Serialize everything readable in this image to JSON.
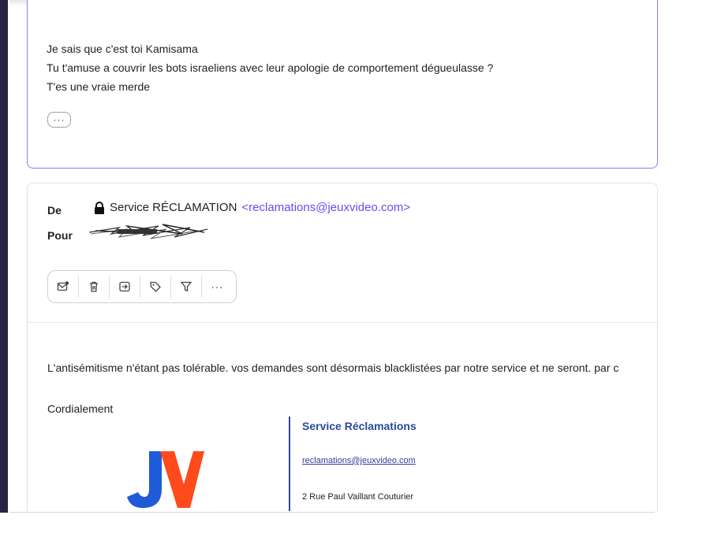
{
  "message1": {
    "lines": [
      "Je sais que c'est toi Kamisama",
      "Tu t'amuse a couvrir les bots israeliens avec leur apologie de comportement dégueulasse ?",
      "T'es une vraie merde"
    ],
    "more_label": "···"
  },
  "message2": {
    "from_label": "De",
    "to_label": "Pour",
    "sender_name": "Service RÉCLAMATION",
    "sender_email": "<reclamations@jeuxvideo.com>",
    "toolbar": {
      "icons": [
        "mark-unread-icon",
        "trash-icon",
        "move-icon",
        "tag-icon",
        "filter-icon",
        "more-icon"
      ],
      "more_label": "···"
    },
    "body": "L'antisémitisme n'étant pas tolérable. vos demandes sont désormais blacklistées par notre service et ne seront. par c",
    "greeting": "Cordialement",
    "signature": {
      "logo_text": "JV",
      "title": "Service Réclamations",
      "email": "reclamations@jeuxvideo.com",
      "address": "2 Rue Paul Vaillant Couturier"
    }
  },
  "colors": {
    "accent": "#8b7cf5",
    "link": "#6a4cf0",
    "logo_blue": "#1f5bd8",
    "logo_orange": "#ff4a1c",
    "signature_blue": "#2b4a9b"
  }
}
